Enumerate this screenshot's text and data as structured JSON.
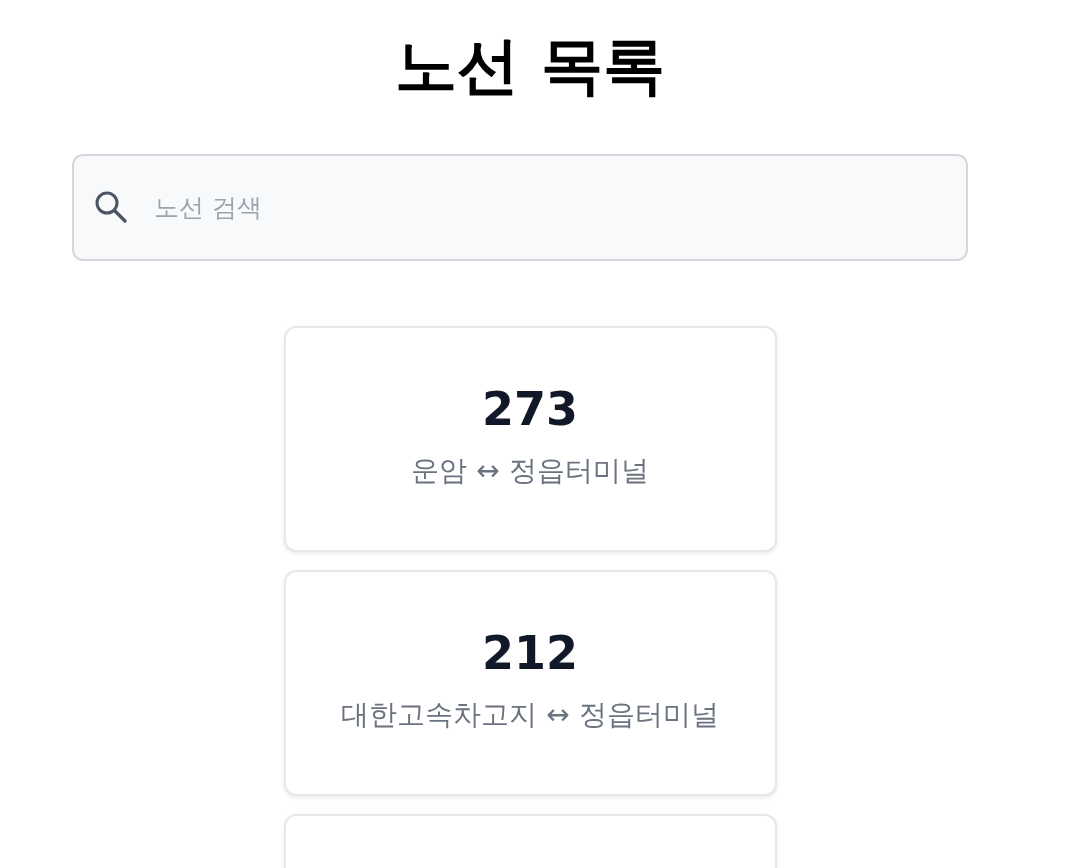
{
  "title": "노선 목록",
  "search": {
    "placeholder": "노선 검색"
  },
  "routes": [
    {
      "kind": "route",
      "number": "273",
      "endpoints": "운암 ↔ 정읍터미널"
    },
    {
      "kind": "route",
      "number": "212",
      "endpoints": "대한고속차고지 ↔ 정읍터미널"
    },
    {
      "kind": "partial"
    }
  ]
}
